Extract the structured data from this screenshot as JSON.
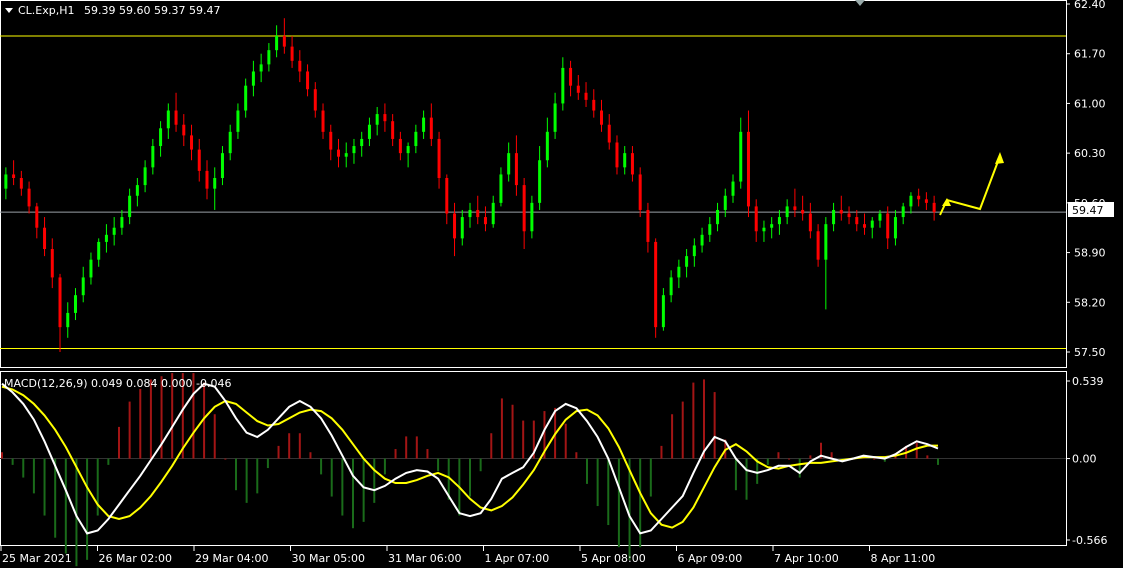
{
  "header": {
    "symbol_label": "CL.Exp,H1",
    "ohlc_text": "59.39 59.60 59.37 59.47",
    "macd_label": "MACD(12,26,9) 0.049 0.084 0.000 -0.046"
  },
  "colors": {
    "background": "#000000",
    "bull": "#00ff00",
    "bear": "#ff0000",
    "hist_up": "#a31515",
    "hist_down": "#1a6b1a",
    "macd": "#ffffff",
    "signal": "#ffff00",
    "level": "#ffff00",
    "frame": "#ffffff"
  },
  "chart_data": [
    {
      "type": "candlestick",
      "ylim": [
        57.5,
        62.4
      ],
      "y_ticks": [
        "62.40",
        "61.70",
        "61.00",
        "60.30",
        "59.60",
        "58.90",
        "58.20",
        "57.50"
      ],
      "x_ticks": [
        "25 Mar 2021",
        "26 Mar 02:00",
        "29 Mar 04:00",
        "30 Mar 05:00",
        "31 Mar 06:00",
        "1 Apr 07:00",
        "5 Apr 08:00",
        "6 Apr 09:00",
        "7 Apr 10:00",
        "8 Apr 11:00"
      ],
      "current_price": "59.47",
      "levels": [
        61.95,
        57.55
      ],
      "path_points": [
        [
          59.8,
          60.1,
          59.65,
          60.0
        ],
        [
          60.0,
          60.2,
          59.85,
          59.95
        ],
        [
          59.95,
          60.05,
          59.7,
          59.8
        ],
        [
          59.8,
          59.9,
          59.45,
          59.55
        ],
        [
          59.55,
          59.6,
          59.1,
          59.25
        ],
        [
          59.25,
          59.4,
          58.85,
          58.95
        ],
        [
          58.95,
          59.1,
          58.4,
          58.55
        ],
        [
          58.55,
          58.6,
          57.5,
          57.85
        ],
        [
          57.85,
          58.2,
          57.7,
          58.05
        ],
        [
          58.05,
          58.4,
          57.95,
          58.3
        ],
        [
          58.3,
          58.7,
          58.2,
          58.55
        ],
        [
          58.55,
          58.9,
          58.45,
          58.8
        ],
        [
          58.8,
          59.1,
          58.7,
          59.05
        ],
        [
          59.05,
          59.3,
          58.9,
          59.15
        ],
        [
          59.15,
          59.4,
          59.0,
          59.25
        ],
        [
          59.25,
          59.5,
          59.15,
          59.4
        ],
        [
          59.4,
          59.8,
          59.3,
          59.7
        ],
        [
          59.7,
          59.95,
          59.55,
          59.85
        ],
        [
          59.85,
          60.2,
          59.75,
          60.1
        ],
        [
          60.1,
          60.5,
          60.0,
          60.4
        ],
        [
          60.4,
          60.75,
          60.25,
          60.65
        ],
        [
          60.65,
          61.0,
          60.5,
          60.9
        ],
        [
          60.9,
          61.15,
          60.6,
          60.7
        ],
        [
          60.7,
          60.85,
          60.4,
          60.55
        ],
        [
          60.55,
          60.7,
          60.2,
          60.35
        ],
        [
          60.35,
          60.5,
          59.9,
          60.05
        ],
        [
          60.05,
          60.2,
          59.65,
          59.8
        ],
        [
          59.8,
          60.1,
          59.5,
          59.95
        ],
        [
          59.95,
          60.4,
          59.85,
          60.3
        ],
        [
          60.3,
          60.7,
          60.2,
          60.6
        ],
        [
          60.6,
          61.0,
          60.5,
          60.9
        ],
        [
          60.9,
          61.35,
          60.8,
          61.25
        ],
        [
          61.25,
          61.6,
          61.1,
          61.45
        ],
        [
          61.45,
          61.7,
          61.3,
          61.55
        ],
        [
          61.55,
          61.85,
          61.45,
          61.75
        ],
        [
          61.75,
          62.1,
          61.65,
          61.95
        ],
        [
          61.95,
          62.2,
          61.7,
          61.8
        ],
        [
          61.8,
          61.95,
          61.5,
          61.6
        ],
        [
          61.6,
          61.75,
          61.3,
          61.45
        ],
        [
          61.45,
          61.55,
          61.1,
          61.2
        ],
        [
          61.2,
          61.3,
          60.8,
          60.9
        ],
        [
          60.9,
          61.0,
          60.5,
          60.6
        ],
        [
          60.6,
          60.7,
          60.2,
          60.35
        ],
        [
          60.35,
          60.5,
          60.1,
          60.25
        ],
        [
          60.25,
          60.45,
          60.1,
          60.3
        ],
        [
          60.3,
          60.5,
          60.15,
          60.4
        ],
        [
          60.4,
          60.6,
          60.25,
          60.5
        ],
        [
          60.5,
          60.8,
          60.4,
          60.7
        ],
        [
          60.7,
          60.95,
          60.55,
          60.85
        ],
        [
          60.85,
          61.0,
          60.6,
          60.75
        ],
        [
          60.75,
          60.85,
          60.4,
          60.5
        ],
        [
          60.5,
          60.6,
          60.2,
          60.3
        ],
        [
          60.3,
          60.45,
          60.1,
          60.4
        ],
        [
          60.4,
          60.7,
          60.3,
          60.6
        ],
        [
          60.6,
          60.9,
          60.5,
          60.8
        ],
        [
          60.8,
          61.0,
          60.4,
          60.5
        ],
        [
          60.5,
          60.6,
          59.8,
          59.95
        ],
        [
          59.95,
          60.0,
          59.3,
          59.45
        ],
        [
          59.45,
          59.6,
          58.85,
          59.1
        ],
        [
          59.1,
          59.5,
          59.0,
          59.4
        ],
        [
          59.4,
          59.6,
          59.25,
          59.5
        ],
        [
          59.5,
          59.7,
          59.3,
          59.4
        ],
        [
          59.4,
          59.55,
          59.2,
          59.3
        ],
        [
          59.3,
          59.7,
          59.25,
          59.6
        ],
        [
          59.6,
          60.1,
          59.55,
          60.0
        ],
        [
          60.0,
          60.45,
          59.9,
          60.3
        ],
        [
          60.3,
          60.55,
          59.7,
          59.85
        ],
        [
          59.85,
          59.95,
          58.95,
          59.2
        ],
        [
          59.2,
          59.7,
          59.1,
          59.6
        ],
        [
          59.6,
          60.4,
          59.5,
          60.2
        ],
        [
          60.2,
          60.8,
          60.1,
          60.6
        ],
        [
          60.6,
          61.15,
          60.5,
          61.0
        ],
        [
          61.0,
          61.65,
          60.9,
          61.5
        ],
        [
          61.5,
          61.6,
          61.1,
          61.25
        ],
        [
          61.25,
          61.4,
          61.05,
          61.15
        ],
        [
          61.15,
          61.3,
          60.95,
          61.05
        ],
        [
          61.05,
          61.2,
          60.8,
          60.9
        ],
        [
          60.9,
          61.05,
          60.6,
          60.7
        ],
        [
          60.7,
          60.85,
          60.35,
          60.45
        ],
        [
          60.45,
          60.55,
          60.0,
          60.1
        ],
        [
          60.1,
          60.4,
          60.0,
          60.3
        ],
        [
          60.3,
          60.4,
          59.9,
          60.0
        ],
        [
          60.0,
          60.1,
          59.4,
          59.5
        ],
        [
          59.5,
          59.6,
          58.9,
          59.05
        ],
        [
          59.05,
          59.1,
          57.7,
          57.85
        ],
        [
          57.85,
          58.4,
          57.8,
          58.3
        ],
        [
          58.3,
          58.65,
          58.2,
          58.55
        ],
        [
          58.55,
          58.8,
          58.4,
          58.7
        ],
        [
          58.7,
          58.95,
          58.55,
          58.85
        ],
        [
          58.85,
          59.1,
          58.7,
          59.0
        ],
        [
          59.0,
          59.25,
          58.9,
          59.15
        ],
        [
          59.15,
          59.4,
          59.05,
          59.3
        ],
        [
          59.3,
          59.6,
          59.2,
          59.5
        ],
        [
          59.5,
          59.8,
          59.4,
          59.7
        ],
        [
          59.7,
          60.0,
          59.6,
          59.9
        ],
        [
          59.9,
          60.8,
          59.8,
          60.6
        ],
        [
          60.6,
          60.9,
          59.4,
          59.55
        ],
        [
          59.55,
          59.65,
          59.05,
          59.2
        ],
        [
          59.2,
          59.35,
          59.05,
          59.25
        ],
        [
          59.25,
          59.4,
          59.1,
          59.3
        ],
        [
          59.3,
          59.5,
          59.15,
          59.4
        ],
        [
          59.4,
          59.65,
          59.3,
          59.55
        ],
        [
          59.55,
          59.8,
          59.4,
          59.5
        ],
        [
          59.5,
          59.7,
          59.35,
          59.45
        ],
        [
          59.45,
          59.6,
          59.1,
          59.2
        ],
        [
          59.2,
          59.3,
          58.7,
          58.8
        ],
        [
          58.8,
          59.4,
          58.1,
          59.3
        ],
        [
          59.3,
          59.6,
          59.2,
          59.5
        ],
        [
          59.5,
          59.7,
          59.35,
          59.45
        ],
        [
          59.45,
          59.55,
          59.3,
          59.4
        ],
        [
          59.4,
          59.5,
          59.2,
          59.3
        ],
        [
          59.3,
          59.45,
          59.15,
          59.25
        ],
        [
          59.25,
          59.4,
          59.1,
          59.35
        ],
        [
          59.35,
          59.5,
          59.25,
          59.45
        ],
        [
          59.45,
          59.55,
          58.95,
          59.1
        ],
        [
          59.1,
          59.5,
          59.0,
          59.4
        ],
        [
          59.4,
          59.6,
          59.3,
          59.55
        ],
        [
          59.55,
          59.75,
          59.45,
          59.7
        ],
        [
          59.7,
          59.8,
          59.55,
          59.65
        ],
        [
          59.65,
          59.75,
          59.5,
          59.6
        ],
        [
          59.6,
          59.7,
          59.35,
          59.47
        ]
      ]
    },
    {
      "type": "line",
      "name": "MACD(12,26,9)",
      "ylim": [
        -0.566,
        0.539
      ],
      "y_ticks": [
        "0.539",
        "0.00",
        "-0.566"
      ],
      "series": [
        {
          "name": "MACD",
          "values": [
            0.52,
            0.46,
            0.38,
            0.27,
            0.12,
            -0.05,
            -0.22,
            -0.4,
            -0.52,
            -0.5,
            -0.42,
            -0.32,
            -0.22,
            -0.12,
            -0.01,
            0.1,
            0.22,
            0.34,
            0.45,
            0.52,
            0.5,
            0.4,
            0.28,
            0.18,
            0.15,
            0.2,
            0.28,
            0.36,
            0.4,
            0.36,
            0.28,
            0.16,
            0.02,
            -0.12,
            -0.2,
            -0.22,
            -0.19,
            -0.14,
            -0.1,
            -0.08,
            -0.09,
            -0.14,
            -0.26,
            -0.38,
            -0.4,
            -0.38,
            -0.28,
            -0.14,
            -0.1,
            -0.06,
            0.04,
            0.2,
            0.33,
            0.38,
            0.35,
            0.26,
            0.15,
            0.0,
            -0.2,
            -0.4,
            -0.52,
            -0.5,
            -0.42,
            -0.34,
            -0.26,
            -0.1,
            0.05,
            0.15,
            0.12,
            0.0,
            -0.08,
            -0.1,
            -0.08,
            -0.05,
            -0.05,
            -0.1,
            -0.02,
            0.02,
            0.0,
            -0.02,
            0.0,
            0.02,
            0.01,
            0.0,
            0.03,
            0.08,
            0.12,
            0.1,
            0.07
          ]
        },
        {
          "name": "Signal",
          "values": [
            0.5,
            0.48,
            0.44,
            0.38,
            0.3,
            0.2,
            0.08,
            -0.06,
            -0.2,
            -0.32,
            -0.4,
            -0.42,
            -0.4,
            -0.34,
            -0.26,
            -0.16,
            -0.05,
            0.07,
            0.18,
            0.28,
            0.36,
            0.4,
            0.38,
            0.32,
            0.26,
            0.23,
            0.24,
            0.28,
            0.32,
            0.34,
            0.33,
            0.28,
            0.2,
            0.1,
            0.0,
            -0.08,
            -0.14,
            -0.17,
            -0.17,
            -0.15,
            -0.12,
            -0.1,
            -0.13,
            -0.2,
            -0.28,
            -0.34,
            -0.36,
            -0.33,
            -0.27,
            -0.18,
            -0.08,
            0.05,
            0.17,
            0.27,
            0.33,
            0.34,
            0.3,
            0.21,
            0.08,
            -0.08,
            -0.24,
            -0.38,
            -0.46,
            -0.48,
            -0.44,
            -0.34,
            -0.2,
            -0.06,
            0.06,
            0.1,
            0.05,
            -0.02,
            -0.06,
            -0.07,
            -0.05,
            -0.04,
            -0.03,
            -0.03,
            -0.02,
            -0.01,
            0.0,
            0.01,
            0.01,
            0.01,
            0.02,
            0.04,
            0.07,
            0.09,
            0.09
          ]
        }
      ]
    }
  ]
}
